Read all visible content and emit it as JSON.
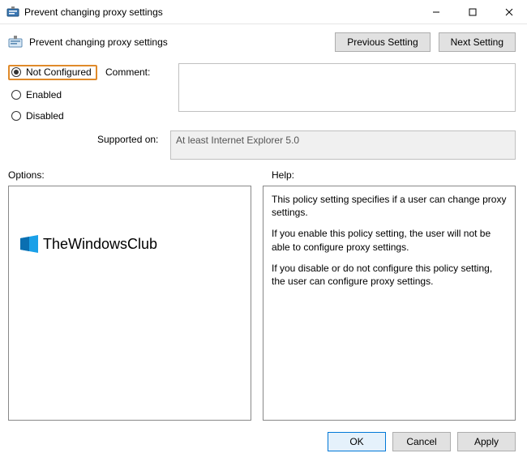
{
  "window": {
    "title": "Prevent changing proxy settings"
  },
  "header": {
    "policy_name": "Prevent changing proxy settings",
    "prev_btn": "Previous Setting",
    "next_btn": "Next Setting"
  },
  "state": {
    "not_configured": "Not Configured",
    "enabled": "Enabled",
    "disabled": "Disabled",
    "selected": "not_configured"
  },
  "labels": {
    "comment": "Comment:",
    "supported_on": "Supported on:",
    "options": "Options:",
    "help": "Help:"
  },
  "fields": {
    "comment_value": "",
    "supported_value": "At least Internet Explorer 5.0"
  },
  "help": {
    "p1": "This policy setting specifies if a user can change proxy settings.",
    "p2": "If you enable this policy setting, the user will not be able to configure proxy settings.",
    "p3": "If you disable or do not configure this policy setting, the user can configure proxy settings."
  },
  "footer": {
    "ok": "OK",
    "cancel": "Cancel",
    "apply": "Apply"
  },
  "watermark": {
    "text": "TheWindowsClub"
  }
}
